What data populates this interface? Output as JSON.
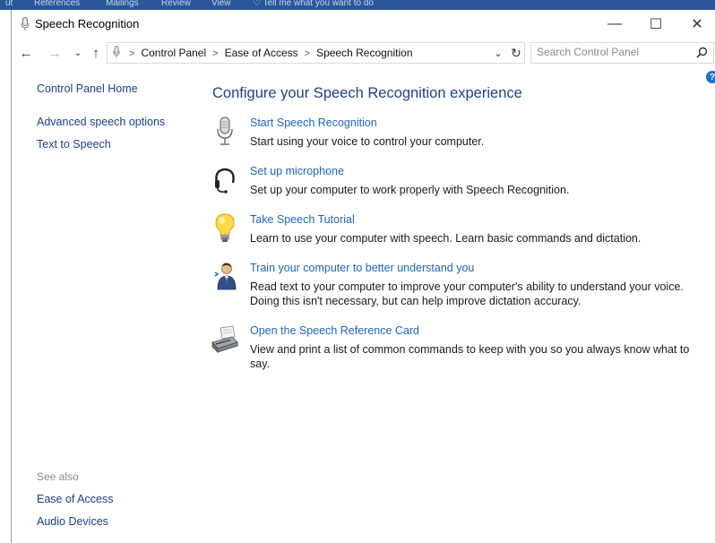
{
  "ribbon": {
    "items": [
      "ut",
      "References",
      "Mailings",
      "Review",
      "View",
      "♡ Tell me what you want to do"
    ]
  },
  "window": {
    "title": "Speech Recognition",
    "controls": {
      "minimize": "—",
      "maximize": "☐",
      "close": "✕"
    }
  },
  "nav": {
    "back": "←",
    "forward": "→",
    "recent": "⌄",
    "up": "↑",
    "breadcrumbs": [
      "Control Panel",
      "Ease of Access",
      "Speech Recognition"
    ],
    "separator": ">",
    "dropdown": "⌄",
    "refresh": "↻"
  },
  "search": {
    "placeholder": "Search Control Panel",
    "icon": "search-icon"
  },
  "help": {
    "label": "?"
  },
  "sidebar": {
    "home": "Control Panel Home",
    "links": [
      "Advanced speech options",
      "Text to Speech"
    ],
    "see_also_heading": "See also",
    "see_also": [
      "Ease of Access",
      "Audio Devices"
    ]
  },
  "main": {
    "title": "Configure your Speech Recognition experience",
    "tasks": [
      {
        "icon": "microphone-icon",
        "label": "Start Speech Recognition",
        "description": "Start using your voice to control your computer."
      },
      {
        "icon": "headset-icon",
        "label": "Set up microphone",
        "description": "Set up your computer to work properly with Speech Recognition."
      },
      {
        "icon": "lightbulb-icon",
        "label": "Take Speech Tutorial",
        "description": "Learn to use your computer with speech.  Learn basic commands and dictation."
      },
      {
        "icon": "user-icon",
        "label": "Train your computer to better understand you",
        "description": "Read text to your computer to improve your computer's ability to understand your voice. Doing this isn't necessary, but can help improve dictation accuracy."
      },
      {
        "icon": "printer-icon",
        "label": "Open the Speech Reference Card",
        "description": "View and print a list of common commands to keep with you so you always know what to say."
      }
    ]
  },
  "colors": {
    "ribbon": "#2b579a",
    "link": "#1e64c8",
    "heading": "#1f3f8f",
    "nav_link": "#1a3f8f",
    "muted": "#8a8a8a"
  }
}
